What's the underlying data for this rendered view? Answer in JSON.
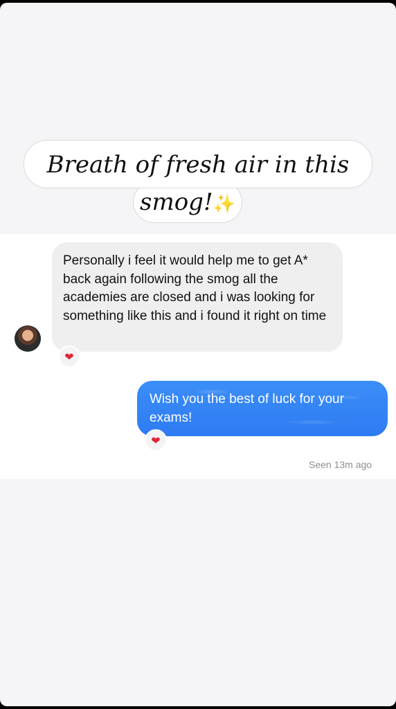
{
  "caption": {
    "line1": "Breath of fresh air in this",
    "line2": "smog!",
    "sparkle_icon": "sparkles-icon"
  },
  "messages": [
    {
      "direction": "incoming",
      "text": "Personally i feel it would help me to get A* back again following the smog all the academies are closed and i was looking for something like this and i found it right on time",
      "reaction": "❤"
    },
    {
      "direction": "outgoing",
      "text": "Wish you the best of luck for your exams!",
      "reaction": "❤"
    }
  ],
  "status": {
    "seen": "Seen 13m ago"
  },
  "colors": {
    "outgoing_bubble": "#2e7bf3",
    "incoming_bubble": "#efefef",
    "reaction_heart": "#e0263b"
  }
}
